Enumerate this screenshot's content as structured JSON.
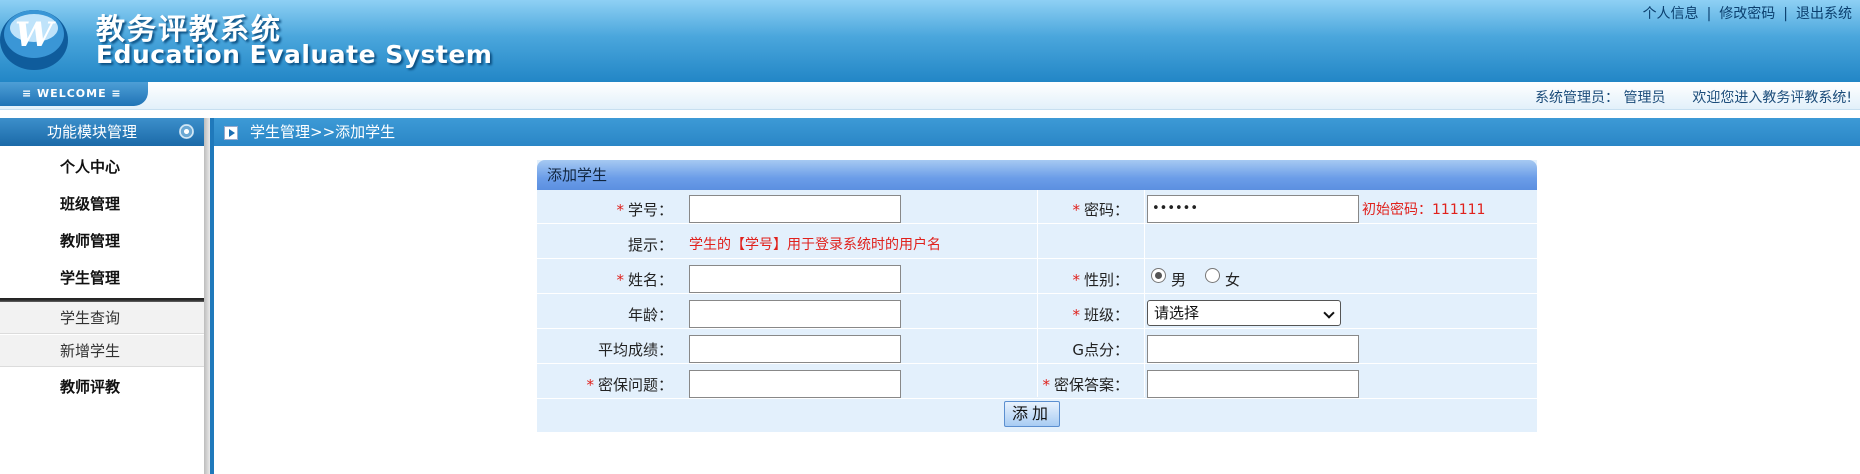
{
  "header": {
    "title_cn": "教务评教系统",
    "title_en": "Education Evaluate System",
    "links": [
      "个人信息",
      "修改密码",
      "退出系统"
    ],
    "separator": "|"
  },
  "welcome": {
    "tab_label": "≡  WELCOME  ≡",
    "role_label": "系统管理员：",
    "user_name": "管理员",
    "greeting": "欢迎您进入教务评教系统!"
  },
  "sidebar": {
    "title": "功能模块管理",
    "items": [
      {
        "label": "个人中心"
      },
      {
        "label": "班级管理"
      },
      {
        "label": "教师管理"
      },
      {
        "label": "学生管理"
      }
    ],
    "subitems": [
      {
        "label": "学生查询"
      },
      {
        "label": "新增学生"
      }
    ],
    "after_items": [
      {
        "label": "教师评教"
      }
    ]
  },
  "breadcrumb": "学生管理>>添加学生",
  "form": {
    "title": "添加学生",
    "required_mark": "*",
    "student_id_label": "学号：",
    "password_label": "密码：",
    "password_value": "••••••",
    "password_hint": "初始密码：111111",
    "hint_label": "提示：",
    "hint_text": "学生的【学号】用于登录系统时的用户名",
    "name_label": "姓名：",
    "gender_label": "性别：",
    "gender_options": [
      "男",
      "女"
    ],
    "gender_selected": "男",
    "age_label": "年龄：",
    "class_label": "班级：",
    "class_selected": "请选择",
    "avg_score_label": "平均成绩：",
    "g_points_label": "G点分：",
    "security_question_label": "密保问题：",
    "security_answer_label": "密保答案：",
    "submit_label": "添加"
  },
  "colors": {
    "header_blue": "#2286c6",
    "required_red": "#e0211c",
    "panel_bg": "#e3f0fc"
  }
}
